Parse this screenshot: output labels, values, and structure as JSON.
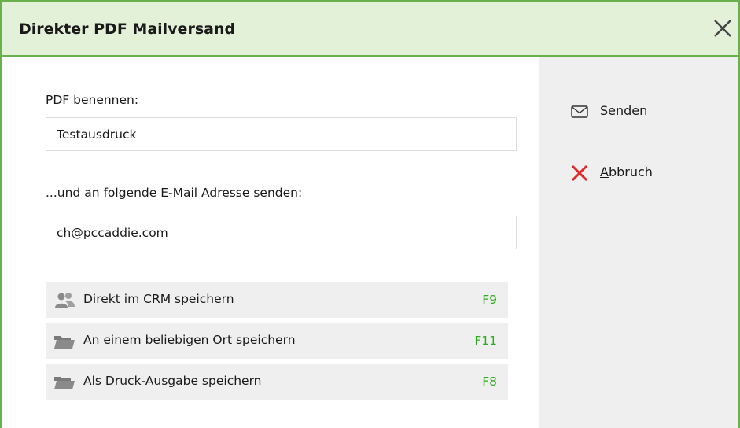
{
  "dialog": {
    "title": "Direkter PDF Mailversand",
    "close_icon": "close-icon"
  },
  "form": {
    "pdf_name_label": "PDF benennen:",
    "pdf_name_value": "Testausdruck",
    "email_label": "...und an folgende E-Mail Adresse senden:",
    "email_value": "ch@pccaddie.com"
  },
  "save_options": [
    {
      "label": "Direkt im CRM speichern",
      "key": "F9",
      "icon": "crm-users-icon"
    },
    {
      "label": "An einem beliebigen Ort speichern",
      "key": "F11",
      "icon": "folder-icon"
    },
    {
      "label": "Als Druck-Ausgabe speichern",
      "key": "F8",
      "icon": "folder-icon"
    }
  ],
  "actions": {
    "send": {
      "mnemonic": "S",
      "rest": "enden",
      "icon": "envelope-icon"
    },
    "cancel": {
      "mnemonic": "A",
      "rest": "bbruch",
      "icon": "close-red-icon"
    }
  },
  "colors": {
    "accent_border": "#6ab04c",
    "title_bg": "#e4f1d9",
    "shortcut_green": "#2eae1e",
    "cancel_red": "#e0282a",
    "panel_bg": "#efefef"
  }
}
